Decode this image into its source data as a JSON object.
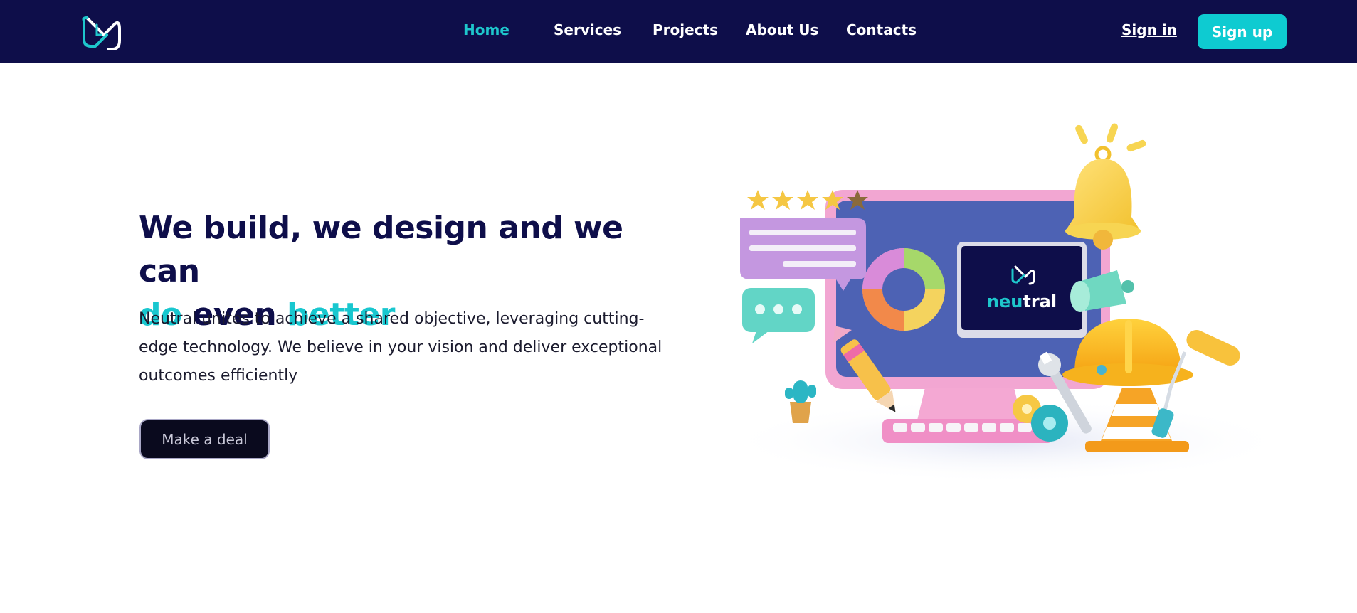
{
  "nav": {
    "links": [
      "Home",
      "Services",
      "Projects",
      "About Us",
      "Contacts"
    ],
    "active": "Home",
    "sign_in": "Sign in",
    "sign_up": "Sign up"
  },
  "hero": {
    "title_line1": "We build, we design and we can",
    "title_do": "do",
    "title_even": " even ",
    "title_better": "better",
    "description": "Neutral unites to achieve a shared objective, leveraging cutting-edge technology. We believe in your vision and deliver exceptional outcomes efficiently",
    "cta": "Make a deal"
  },
  "illustration": {
    "screen_logo_text_neu": "neu",
    "screen_logo_text_tral": "tral",
    "rating_stars": 4.5
  },
  "colors": {
    "navbar": "#0e0e4a",
    "accent": "#19c7cf",
    "title": "#0e0e4a",
    "cta_bg": "#0a0a1e"
  }
}
